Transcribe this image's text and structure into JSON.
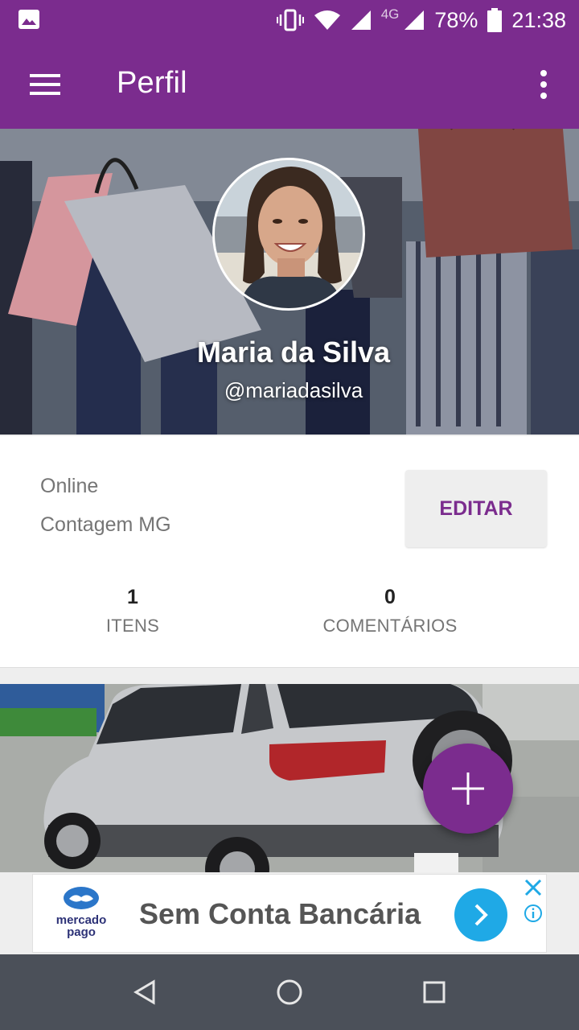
{
  "status_bar": {
    "battery": "78%",
    "time": "21:38",
    "network": "4G",
    "icons": [
      "image-icon",
      "vibrate-icon",
      "wifi-icon",
      "signal-icon",
      "battery-icon"
    ]
  },
  "app_bar": {
    "title": "Perfil",
    "menu_icon": "hamburger-menu-icon",
    "overflow_icon": "more-vert-icon"
  },
  "profile": {
    "name": "Maria da Silva",
    "handle": "@mariadasilva",
    "status": "Online",
    "location": "Contagem MG",
    "edit_label": "EDITAR",
    "stats": [
      {
        "value": "1",
        "label": "ITENS"
      },
      {
        "value": "0",
        "label": "COMENTÁRIOS"
      }
    ]
  },
  "fab": {
    "icon": "plus-icon"
  },
  "ad": {
    "logo_line1": "mercado",
    "logo_line2": "pago",
    "text": "Sem Conta Bancária"
  },
  "nav_bar": {
    "icons": [
      "back-icon",
      "home-icon",
      "recents-icon"
    ]
  },
  "colors": {
    "primary": "#7b2c8e",
    "ad_button": "#1fa9e6",
    "nav_bar": "#4b5059"
  }
}
